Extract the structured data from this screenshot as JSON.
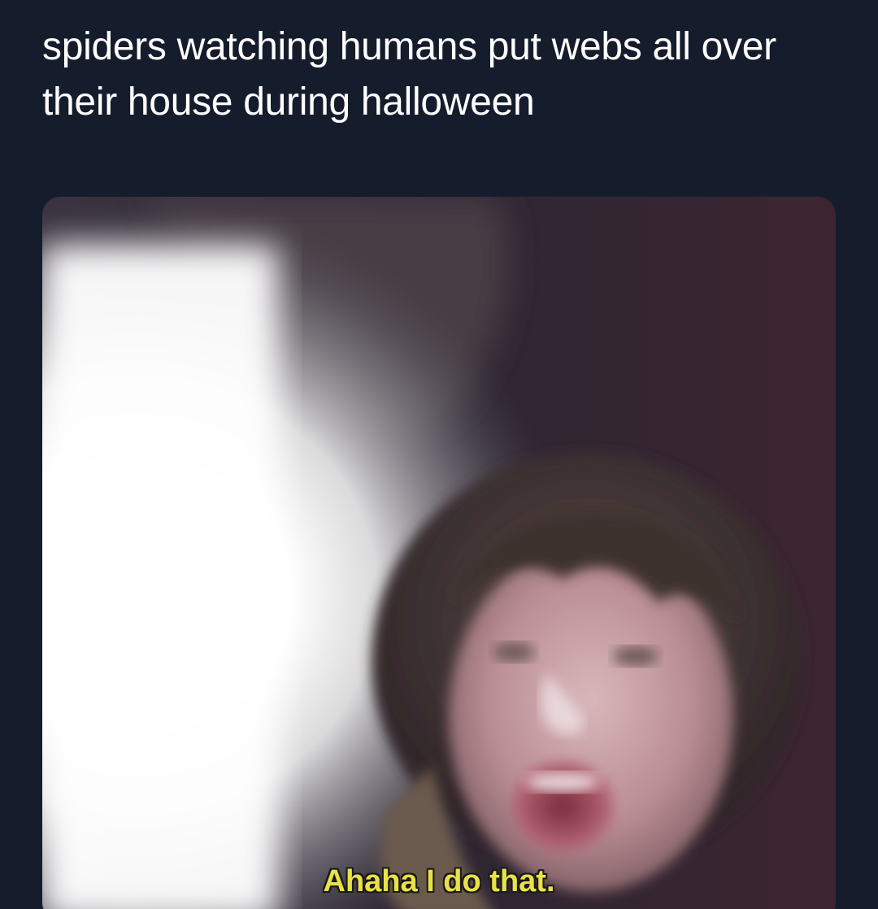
{
  "post": {
    "caption": "spiders watching humans put webs all over their house during halloween"
  },
  "video": {
    "subtitle": "Ahaha I do that.",
    "subtitle_color": "#e9e247"
  },
  "colors": {
    "background": "#151c2c",
    "caption_text": "#ffffff"
  }
}
